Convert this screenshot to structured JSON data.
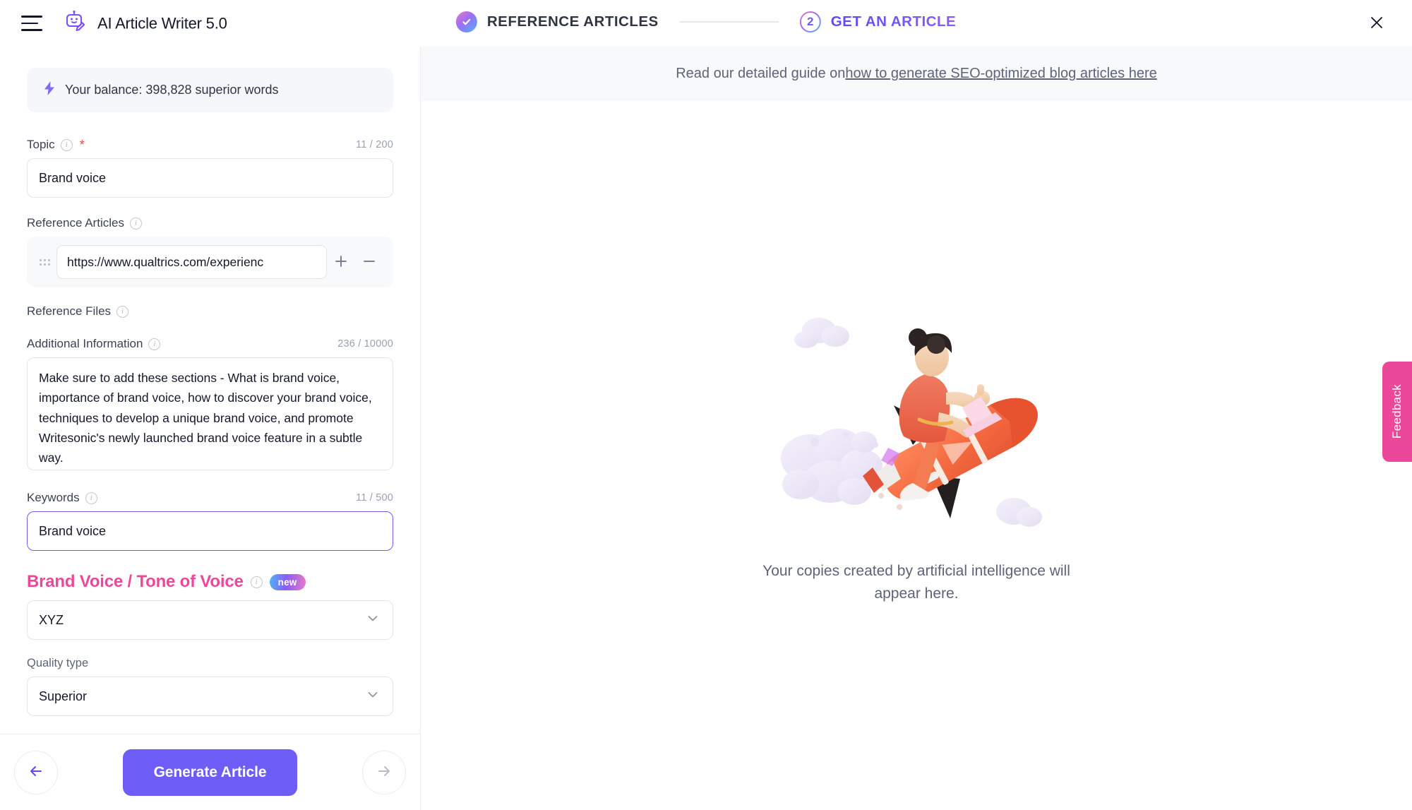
{
  "header": {
    "menu_icon": "hamburger-icon",
    "logo_icon": "robot-pencil-icon",
    "app_title": "AI Article Writer 5.0",
    "close_icon": "close-icon",
    "steps": [
      {
        "label": "REFERENCE ARTICLES",
        "state": "completed",
        "marker": "check-icon"
      },
      {
        "label": "GET AN ARTICLE",
        "state": "active",
        "marker": "2"
      }
    ]
  },
  "sidebar": {
    "balance": {
      "icon": "lightning-bolt-icon",
      "text": "Your balance: 398,828 superior words"
    },
    "topic": {
      "label": "Topic",
      "required_marker": "*",
      "counter": "11 / 200",
      "value": "Brand voice",
      "placeholder": "Enter your topic"
    },
    "reference_articles": {
      "label": "Reference Articles",
      "value": "https://www.qualtrics.com/experienc",
      "placeholder": "Enter article URL",
      "add_icon": "plus-icon",
      "remove_icon": "minus-icon",
      "drag_icon": "drag-handle-icon"
    },
    "reference_files": {
      "label": "Reference Files"
    },
    "additional_information": {
      "label": "Additional Information",
      "counter": "236 / 10000",
      "value": "Make sure to add these sections - What is brand voice, importance of brand voice, how to discover your brand voice, techniques to develop a unique brand voice, and promote Writesonic's newly launched brand voice feature in a subtle way.",
      "placeholder": "Add any additional information"
    },
    "keywords": {
      "label": "Keywords",
      "counter": "11 / 500",
      "value": "Brand voice",
      "placeholder": "Enter keywords",
      "focused": true
    },
    "brand_voice": {
      "title": "Brand Voice / Tone of Voice",
      "badge": "new",
      "selected": "XYZ"
    },
    "quality_type": {
      "label": "Quality type",
      "selected": "Superior"
    }
  },
  "footer": {
    "back_icon": "arrow-left-icon",
    "generate_label": "Generate Article",
    "forward_icon": "arrow-right-icon"
  },
  "main": {
    "guide_prefix": "Read our detailed guide on ",
    "guide_link": "how to generate SEO-optimized blog articles here",
    "illustration": "rocket-with-person-illustration",
    "empty_message": "Your copies created by artificial intelligence will appear here."
  },
  "feedback": {
    "label": "Feedback"
  },
  "colors": {
    "primary": "#6d5df6",
    "accent_pink": "#ec4899",
    "text_dark": "#14182b",
    "text_muted": "#5d6478",
    "border": "#e3e5ec",
    "panel_bg": "#f8f9fb"
  }
}
